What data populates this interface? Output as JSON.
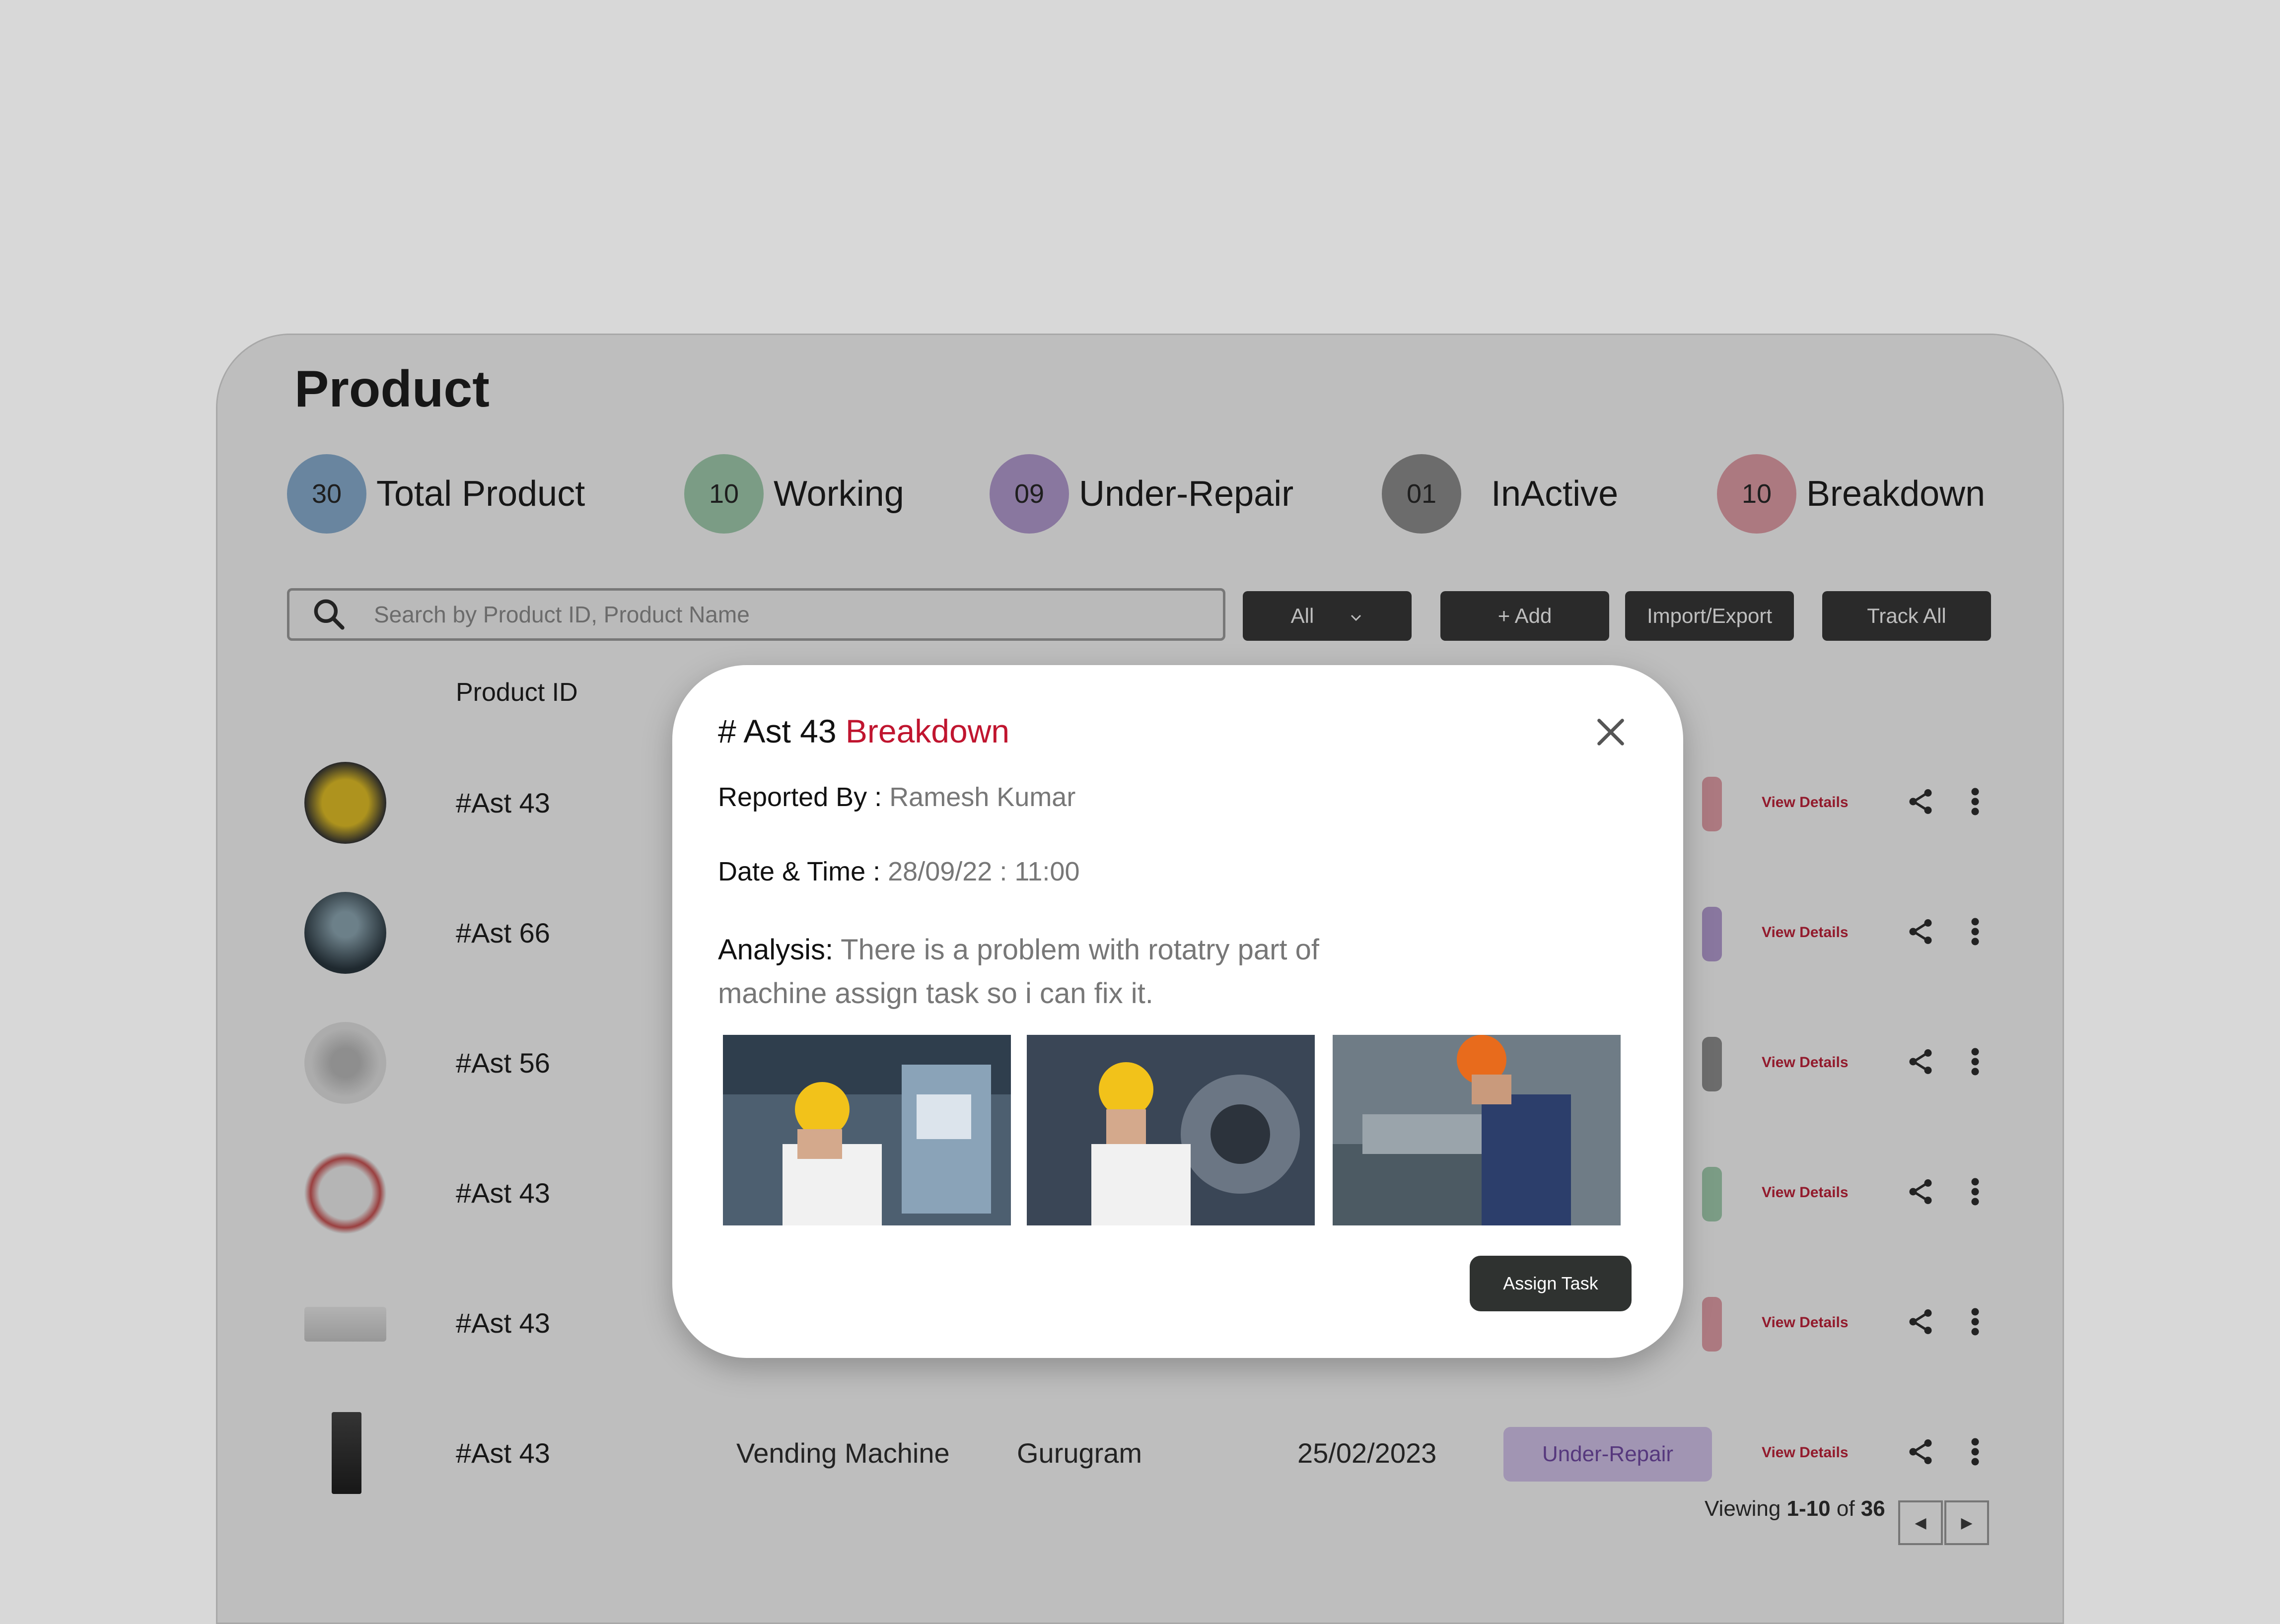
{
  "page": {
    "title": "Product"
  },
  "stats": [
    {
      "count": "30",
      "label": "Total Product",
      "color": "#86aed3"
    },
    {
      "count": "10",
      "label": "Working",
      "color": "#9fcfae"
    },
    {
      "count": "09",
      "label": "Under-Repair",
      "color": "#b49ad3"
    },
    {
      "count": "01",
      "label": "InActive",
      "color": "#8a8a8a"
    },
    {
      "count": "10",
      "label": "Breakdown",
      "color": "#e59ca6"
    }
  ],
  "toolbar": {
    "search_placeholder": "Search by Product ID, Product Name",
    "filter_value": "All",
    "add_label": "+ Add",
    "import_export_label": "Import/Export",
    "track_all_label": "Track All"
  },
  "table": {
    "header_product_id": "Product ID",
    "view_details_label": "View Details",
    "rows": [
      {
        "id": "#Ast 43",
        "status_color": "#e59ca6",
        "icon": "generator-icon"
      },
      {
        "id": "#Ast 66",
        "status_color": "#b49ad3",
        "icon": "escalator-icon"
      },
      {
        "id": "#Ast 56",
        "status_color": "#8a8a8a",
        "icon": "elevator-icon"
      },
      {
        "id": "#Ast 43",
        "status_color": "#9fcfae",
        "icon": "water-tank-icon"
      },
      {
        "id": "#Ast 43",
        "status_color": "#e59ca6",
        "icon": "air-conditioner-icon"
      },
      {
        "id": "#Ast 43",
        "name": "Vending Machine",
        "location": "Gurugram",
        "date": "25/02/2023",
        "status": "Under-Repair",
        "status_color": "#d6c4ef",
        "icon": "vending-machine-icon"
      }
    ]
  },
  "pagination": {
    "prefix": "Viewing",
    "range": "1-10",
    "of": "of",
    "total": "36"
  },
  "modal": {
    "hash": "#",
    "asset": "Ast 43",
    "status": "Breakdown",
    "reported_by_label": "Reported By :",
    "reported_by_value": "Ramesh Kumar",
    "datetime_label": "Date & Time :",
    "datetime_value": "28/09/22 : 11:00",
    "analysis_label": "Analysis:",
    "analysis_value": "There is a problem with rotatry part of machine assign task so i can fix it.",
    "assign_label": "Assign Task",
    "accent_color": "#c0152f"
  }
}
